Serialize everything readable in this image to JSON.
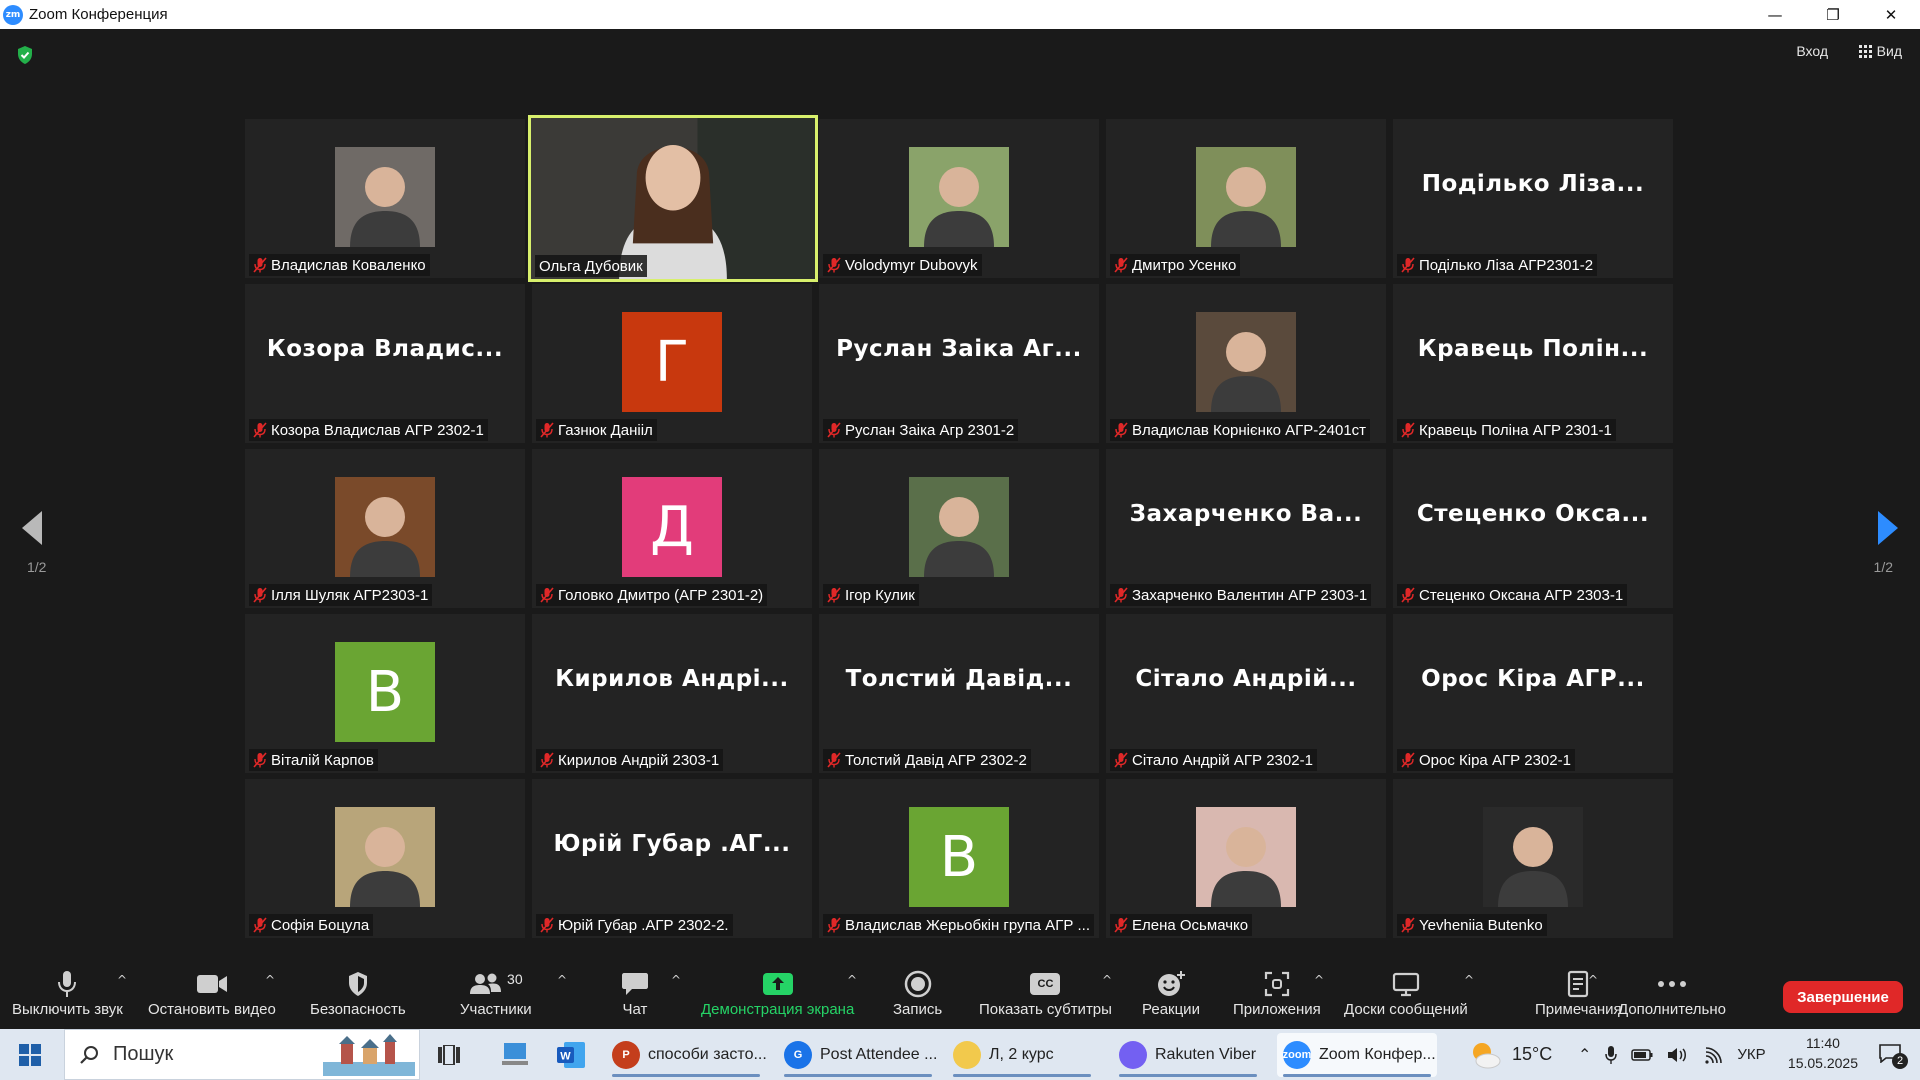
{
  "window": {
    "logo_text": "zm",
    "title": "Zoom Конференция",
    "minimize": "—",
    "restore": "❐",
    "close": "✕"
  },
  "top_right": {
    "login_label": "Вход",
    "view_label": "Вид"
  },
  "pagination": {
    "prev": "1/2",
    "next": "1/2"
  },
  "tiles": [
    {
      "label": "Владислав Коваленко",
      "type": "photo",
      "muted": true,
      "color": "#6f6a66"
    },
    {
      "label": "Ольга Дубовик",
      "type": "video",
      "muted": false,
      "active": true,
      "color": "#3b3a37"
    },
    {
      "label": "Volodymyr Dubovyk",
      "type": "photo",
      "muted": true,
      "color": "#8aa36a"
    },
    {
      "label": "Дмитро Усенко",
      "type": "photo",
      "muted": true,
      "color": "#7f8f5a"
    },
    {
      "label": "Подiлько Лiза АГР2301-2",
      "type": "name",
      "muted": true,
      "bigname": "Подiлько Лiза..."
    },
    {
      "label": "Козора Владислав АГР 2302-1",
      "type": "name",
      "muted": true,
      "bigname": "Козора Владис..."
    },
    {
      "label": "Газнюк Данiiл",
      "type": "letter",
      "muted": true,
      "letter": "Г",
      "color": "#c8380e"
    },
    {
      "label": "Руслан Заiка Агр 2301-2",
      "type": "name",
      "muted": true,
      "bigname": "Руслан Заiка Аг..."
    },
    {
      "label": "Владислав Корнiєнко АГР-2401ст",
      "type": "photo",
      "muted": true,
      "color": "#5a4a3c"
    },
    {
      "label": "Кравець Полiна АГР 2301-1",
      "type": "name",
      "muted": true,
      "bigname": "Кравець Полiн..."
    },
    {
      "label": "Iлля Шуляк АГР2303-1",
      "type": "photo",
      "muted": true,
      "color": "#7a4a2a"
    },
    {
      "label": "Головко Дмитро (АГР 2301-2)",
      "type": "letter",
      "muted": true,
      "letter": "Д",
      "color": "#e23c7a"
    },
    {
      "label": "Iгор Кулик",
      "type": "photo",
      "muted": true,
      "color": "#5a6f4a"
    },
    {
      "label": "Захарченко Валентин АГР 2303-1",
      "type": "name",
      "muted": true,
      "bigname": "Захарченко Ва..."
    },
    {
      "label": "Стеценко Оксана АГР 2303-1",
      "type": "name",
      "muted": true,
      "bigname": "Стеценко Окса..."
    },
    {
      "label": "Вiталiй Карпов",
      "type": "letter",
      "muted": true,
      "letter": "В",
      "color": "#6aa533"
    },
    {
      "label": "Кирилов Андрiй 2303-1",
      "type": "name",
      "muted": true,
      "bigname": "Кирилов Андрi..."
    },
    {
      "label": "Толстий Давiд АГР 2302-2",
      "type": "name",
      "muted": true,
      "bigname": "Толстий Давiд..."
    },
    {
      "label": "Сiтало Андрiй АГР 2302-1",
      "type": "name",
      "muted": true,
      "bigname": "Сiтало Андрiй..."
    },
    {
      "label": "Орос Кiра АГР 2302-1",
      "type": "name",
      "muted": true,
      "bigname": "Орос Кiра АГР..."
    },
    {
      "label": "Софiя Боцула",
      "type": "photo",
      "muted": true,
      "color": "#b8a57a"
    },
    {
      "label": "Юрiй Губар .АГР 2302-2.",
      "type": "name",
      "muted": true,
      "bigname": "Юрiй Губар .АГ..."
    },
    {
      "label": "Владислав Жерьобкiн група АГР ...",
      "type": "letter",
      "muted": true,
      "letter": "В",
      "color": "#6aa533"
    },
    {
      "label": "Елена Осьмачко",
      "type": "photo",
      "muted": true,
      "color": "#d9b8b0"
    },
    {
      "label": "Yevheniia Butenko",
      "type": "photo",
      "muted": true,
      "color": "#2a2a2a"
    }
  ],
  "toolbar": {
    "mute": "Выключить звук",
    "video": "Остановить видео",
    "security": "Безопасность",
    "participants": "Участники",
    "participants_count": "30",
    "chat": "Чат",
    "share": "Демонстрация экрана",
    "record": "Запись",
    "captions": "Показать субтитры",
    "captions_icon_text": "CC",
    "reactions": "Реакции",
    "apps": "Приложения",
    "whiteboards": "Доски сообщений",
    "notes": "Примечания",
    "more": "Дополнительно",
    "end": "Завершение"
  },
  "taskbar": {
    "search_placeholder": "Пошук",
    "apps": [
      {
        "label": "способи засто...",
        "icon_color": "#c43e1c",
        "icon_text": "P"
      },
      {
        "label": "Post Attendee ...",
        "icon_color": "#1a73e8",
        "icon_text": "G"
      },
      {
        "label": "Л, 2 курс",
        "icon_color": "#f2c94c",
        "icon_text": ""
      },
      {
        "label": "Rakuten Viber",
        "icon_color": "#7360f2",
        "icon_text": ""
      },
      {
        "label": "Zoom Конфер...",
        "icon_color": "#2d8cff",
        "icon_text": "zoom"
      }
    ],
    "temperature": "15°C",
    "language": "УКР",
    "time": "11:40",
    "date": "15.05.2025",
    "notifications": "2"
  }
}
